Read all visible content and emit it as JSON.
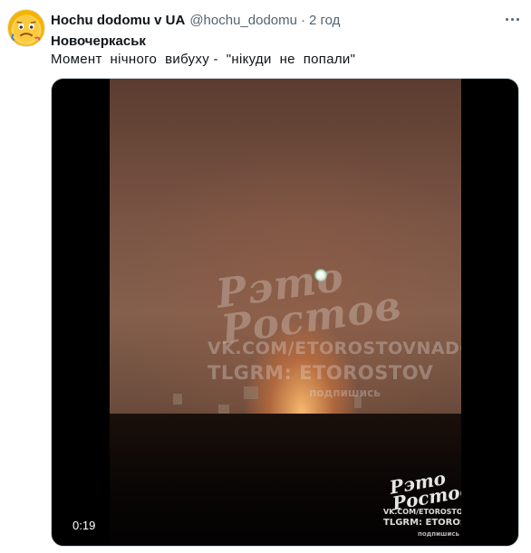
{
  "tweet": {
    "author": {
      "display_name": "Hochu dodomu v UA",
      "handle": "@hochu_dodomu",
      "separator": "·",
      "time": "2 год"
    },
    "title": "Новочеркаськ",
    "text": "Момент  нічного  вибуху -  \"нікуди  не  попали\"",
    "more_icon": "more-icon",
    "media": {
      "duration": "0:19",
      "watermark": {
        "logo": "Рэто\nРостов",
        "vk": "VK.COM/ETOROSTOVNADONU",
        "telegram": "TLGRM: ETOROSTOV",
        "sub": "подпишись"
      },
      "watermark_small": {
        "logo": "Рэто\nРостов",
        "vk": "VK.COM/ETOROSTOVNADONU",
        "telegram": "TLGRM: ETOROSTOV",
        "sub": "подпишись"
      }
    }
  },
  "colors": {
    "text_primary": "#0f1419",
    "text_secondary": "#536471",
    "media_background": "#000000"
  }
}
